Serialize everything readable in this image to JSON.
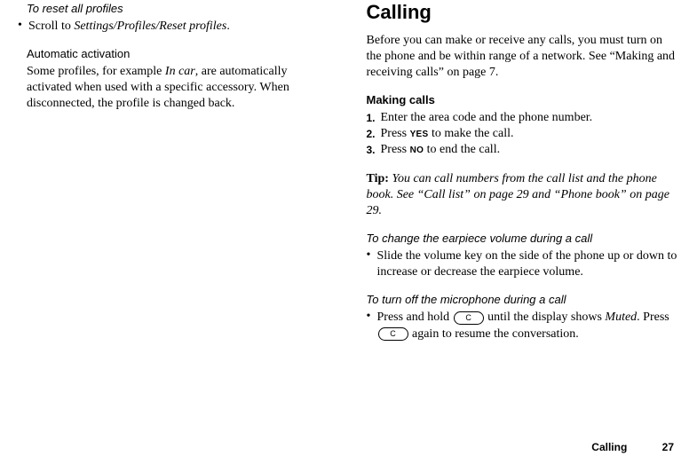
{
  "left": {
    "reset_heading": "To reset all profiles",
    "reset_bullet_prefix": "Scroll to ",
    "reset_path": "Settings/Profiles/Reset profiles",
    "reset_suffix": ".",
    "auto_heading": "Automatic activation",
    "auto_body_1": "Some profiles, for example ",
    "auto_body_italic": "In car",
    "auto_body_2": ", are automatically activated when used with a specific accessory. When disconnected, the profile is changed back."
  },
  "right": {
    "title": "Calling",
    "intro": "Before you can make or receive any calls, you must turn on the phone and be within range of a network. See “Making and receiving calls” on page 7.",
    "making_heading": "Making calls",
    "step1": "Enter the area code and the phone number.",
    "step2_a": "Press ",
    "step2_key": "YES",
    "step2_b": " to make the call.",
    "step3_a": "Press ",
    "step3_key": "NO",
    "step3_b": " to end the call.",
    "tip_label": "Tip: ",
    "tip_body": "You can call numbers from the call list and the phone book. See “Call list” on page 29 and “Phone book” on page 29.",
    "vol_heading": "To change the earpiece volume during a call",
    "vol_bullet": "Slide the volume key on the side of the phone up or down to increase or decrease the earpiece volume.",
    "mic_heading": "To turn off the microphone during a call",
    "mic_a": "Press and hold ",
    "mic_key": "C",
    "mic_b": " until the display shows ",
    "mic_muted": "Muted",
    "mic_c": ". Press ",
    "mic_d": " again to resume the conversation."
  },
  "footer": {
    "section": "Calling",
    "page": "27"
  }
}
